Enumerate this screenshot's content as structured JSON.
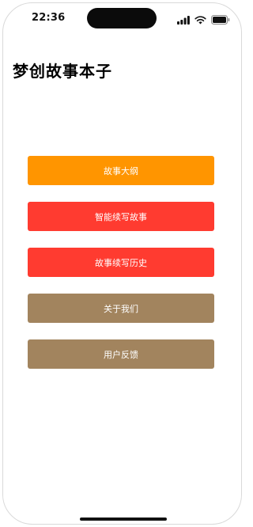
{
  "status_bar": {
    "time": "22:36",
    "icons": [
      "signal-icon",
      "wifi-icon",
      "battery-icon"
    ]
  },
  "header": {
    "title": "梦创故事本子"
  },
  "menu": {
    "items": [
      {
        "label": "故事大纲",
        "color": "#FF9500"
      },
      {
        "label": "智能续写故事",
        "color": "#FF3B30"
      },
      {
        "label": "故事续写历史",
        "color": "#FF3B30"
      },
      {
        "label": "关于我们",
        "color": "#A2845E"
      },
      {
        "label": "用户反馈",
        "color": "#A2845E"
      }
    ]
  }
}
